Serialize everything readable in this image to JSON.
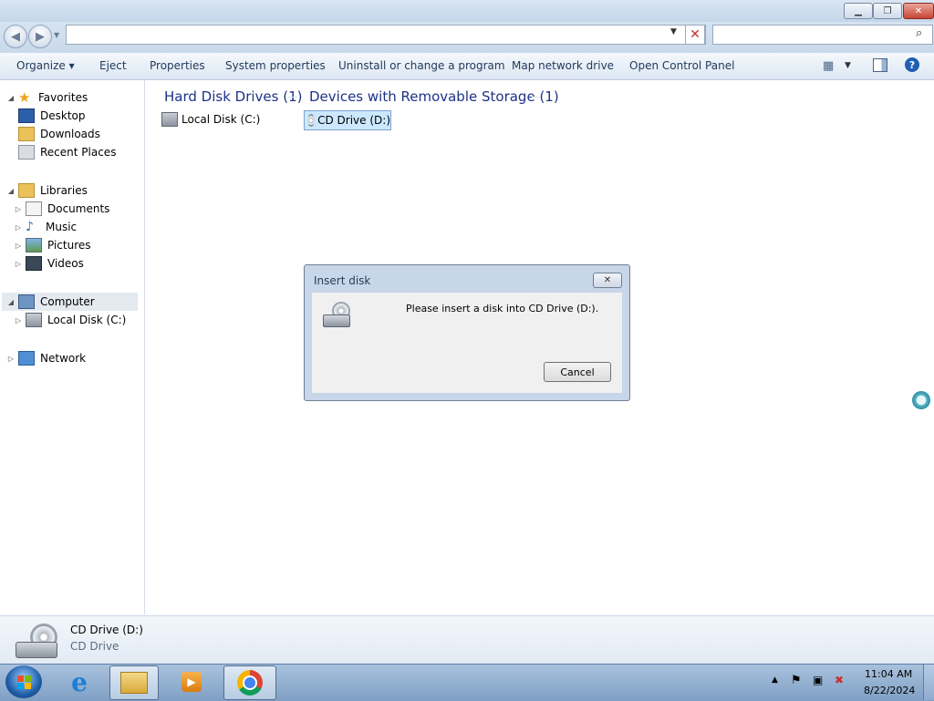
{
  "window": {
    "controls": [
      "minimize",
      "restore",
      "close"
    ]
  },
  "address": {
    "value": "",
    "search_placeholder": ""
  },
  "toolbar": {
    "organize": "Organize ▾",
    "eject": "Eject",
    "properties": "Properties",
    "system_properties": "System properties",
    "uninstall": "Uninstall or change a program",
    "map_drive": "Map network drive",
    "control_panel": "Open Control Panel"
  },
  "sidebar": {
    "favorites": "Favorites",
    "desktop": "Desktop",
    "downloads": "Downloads",
    "recent": "Recent Places",
    "libraries": "Libraries",
    "documents": "Documents",
    "music": "Music",
    "pictures": "Pictures",
    "videos": "Videos",
    "computer": "Computer",
    "local_disk": "Local Disk (C:)",
    "network": "Network"
  },
  "content": {
    "hdd_header": "Hard Disk Drives (1)",
    "removable_header": "Devices with Removable Storage (1)",
    "local_disk": "Local Disk (C:)",
    "cd_drive": "CD Drive (D:)"
  },
  "dialog": {
    "title": "Insert disk",
    "message": "Please insert a disk into CD Drive (D:).",
    "cancel": "Cancel"
  },
  "details": {
    "name": "CD Drive (D:)",
    "type": "CD Drive"
  },
  "taskbar": {
    "time": "11:04 AM",
    "date": "8/22/2024"
  },
  "colors": {
    "accent": "#1e3287",
    "selection": "#cce8ff",
    "taskbar": "#8aa9cd"
  }
}
